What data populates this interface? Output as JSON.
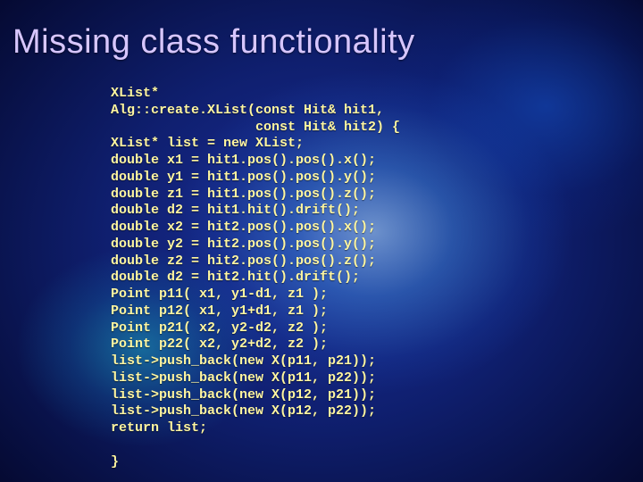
{
  "title": "Missing class functionality",
  "code_lines": [
    "XList*",
    "Alg::create.XList(const Hit& hit1,",
    "                  const Hit& hit2) {",
    "XList* list = new XList;",
    "double x1 = hit1.pos().pos().x();",
    "double y1 = hit1.pos().pos().y();",
    "double z1 = hit1.pos().pos().z();",
    "double d2 = hit1.hit().drift();",
    "double x2 = hit2.pos().pos().x();",
    "double y2 = hit2.pos().pos().y();",
    "double z2 = hit2.pos().pos().z();",
    "double d2 = hit2.hit().drift();",
    "Point p11( x1, y1-d1, z1 );",
    "Point p12( x1, y1+d1, z1 );",
    "Point p21( x2, y2-d2, z2 );",
    "Point p22( x2, y2+d2, z2 );",
    "list->push_back(new X(p11, p21));",
    "list->push_back(new X(p11, p22));",
    "list->push_back(new X(p12, p21));",
    "list->push_back(new X(p12, p22));",
    "return list;",
    "",
    "}"
  ]
}
